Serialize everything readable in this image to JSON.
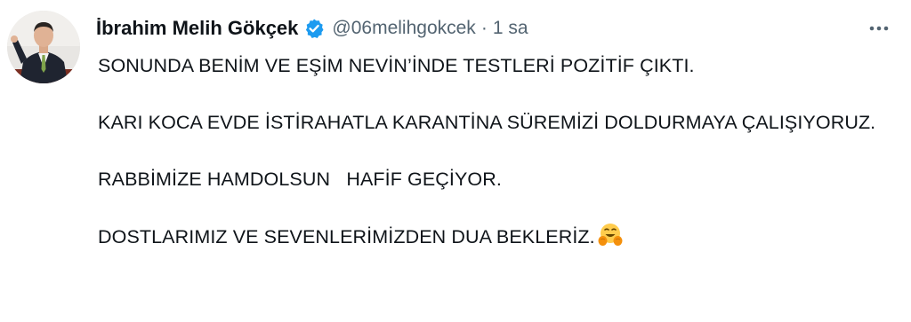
{
  "author": {
    "display_name": "İbrahim Melih Gökçek",
    "handle": "@06melihgokcek",
    "separator": "·",
    "time": "1 sa"
  },
  "icons": {
    "verified": "verified-badge-icon",
    "more": "more-options-icon",
    "emoji": "hugging-face-emoji"
  },
  "colors": {
    "verified_blue": "#1d9bf0",
    "secondary_text": "#536471",
    "primary_text": "#0f1419"
  },
  "tweet": {
    "paragraphs": [
      "SONUNDA BENİM VE EŞİM NEVİN’İNDE TESTLERİ POZİTİF ÇIKTI.",
      "KARI KOCA EVDE İSTİRAHATLA KARANTİNA SÜREMİZİ DOLDURMAYA ÇALIŞIYORUZ.",
      "RABBİMİZE HAMDOLSUN   HAFİF GEÇİYOR.",
      "DOSTLARIMIZ VE SEVENLERİMİZDEN DUA BEKLERİZ."
    ]
  }
}
